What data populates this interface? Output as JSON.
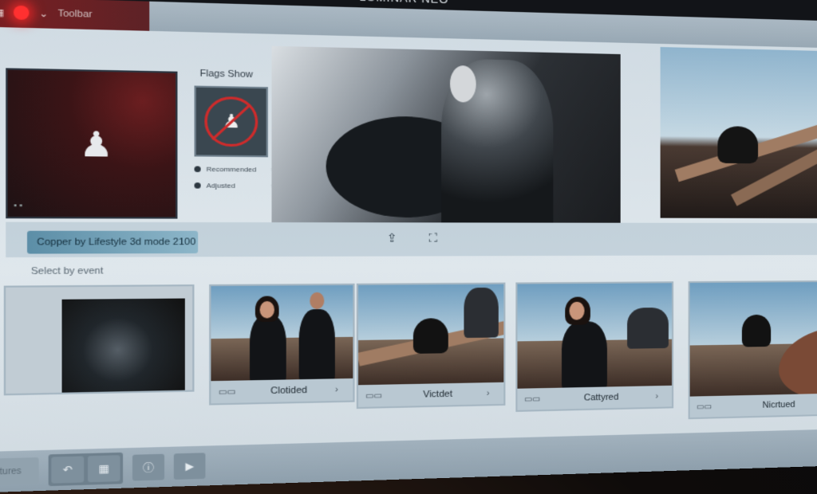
{
  "window": {
    "title": "LUMINAR NEO"
  },
  "titlebar": {
    "menu_icon": "menu-icon",
    "record_label": "",
    "tools_label": "Toolbar"
  },
  "left_panel": {
    "heading": ""
  },
  "mid_panel": {
    "title": "Flags Show",
    "rows": [
      {
        "label": "Recommended",
        "icon": "circle-dot-icon"
      },
      {
        "label": "Adjusted",
        "icon": "circle-dot-icon"
      }
    ]
  },
  "caption": {
    "text": "Copper by Lifestyle 3d mode 2100"
  },
  "main_toolbar": {
    "share_icon": "share-icon",
    "fullscreen_icon": "expand-icon"
  },
  "gallery": {
    "title": "Select by event",
    "cards": [
      {
        "label": "",
        "kind": "dark-object"
      },
      {
        "label": "Clotided",
        "kind": "two-people"
      },
      {
        "label": "Victdet",
        "kind": "rails-sculpture"
      },
      {
        "label": "Cattyred",
        "kind": "woman-seated"
      },
      {
        "label": "Nicrtued",
        "kind": "rails-closeup"
      }
    ]
  },
  "statusbar": {
    "left_label": "Pictures",
    "buttons": [
      "back-icon",
      "grid-icon",
      "info-icon",
      "play-icon"
    ]
  },
  "colors": {
    "accent_red": "#ff3030",
    "panel": "#dfe7ec",
    "caption": "#5c8ea7"
  }
}
